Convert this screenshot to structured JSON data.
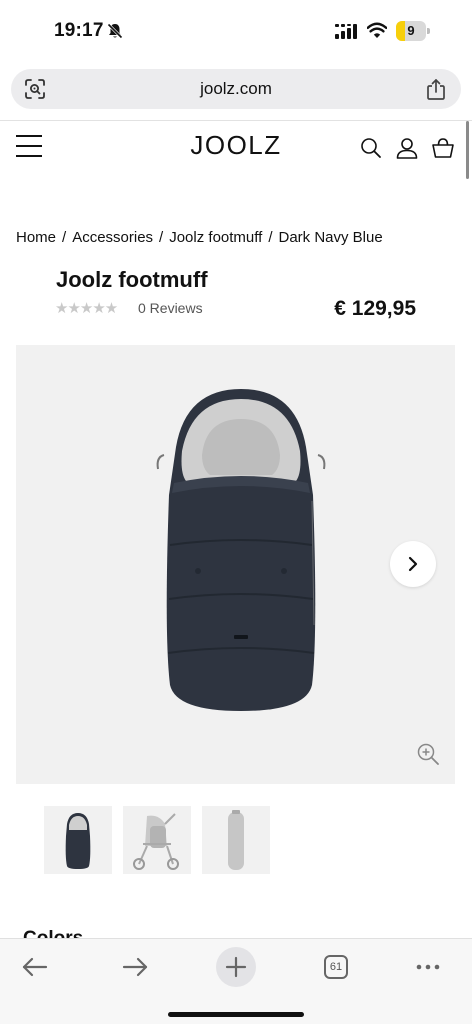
{
  "status_bar": {
    "time": "19:17",
    "battery": "9"
  },
  "browser": {
    "url": "joolz.com",
    "tabs_count": "61"
  },
  "site": {
    "logo": "JOOLZ",
    "icons": [
      "menu-icon",
      "search-icon",
      "account-icon",
      "cart-icon"
    ]
  },
  "breadcrumb": {
    "items": [
      "Home",
      "Accessories",
      "Joolz footmuff",
      "Dark Navy Blue"
    ],
    "separator": "/"
  },
  "product": {
    "title": "Joolz footmuff",
    "rating": 0,
    "stars": "★★★★★",
    "reviews": "0 Reviews",
    "price": "€ 129,95"
  },
  "gallery": {
    "thumbnails": 3,
    "active_thumbnail": 1
  },
  "section": {
    "colors_heading": "Colors"
  },
  "colors": {
    "accent": "#111111",
    "product_navy": "#2e3440",
    "fleece_grey": "#cfcfcf",
    "battery": "#f7cf0b"
  }
}
